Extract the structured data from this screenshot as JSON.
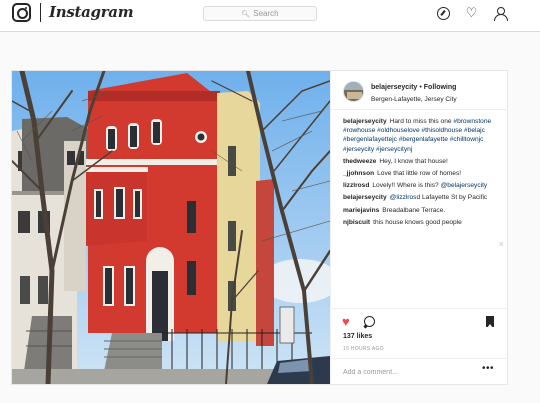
{
  "nav": {
    "wordmark": "Instagram",
    "search_placeholder": "Search",
    "icons": [
      "instagram-logo-icon",
      "compass-icon",
      "heart-icon",
      "profile-icon"
    ]
  },
  "post": {
    "author": "belajerseycity",
    "separator": "•",
    "follow_label": "Following",
    "location": "Bergen-Lafayette, Jersey City",
    "caption_text": "Hard to miss this one",
    "caption_tags": [
      "#brownstone",
      "#rowhouse",
      "#oldhouselove",
      "#thisoldhouse",
      "#belajc",
      "#bergenlafayettejc",
      "#bergenlafayette",
      "#chilltownjc",
      "#jerseycity",
      "#jerseycitynj"
    ],
    "comments": [
      {
        "user": "thedweeze",
        "text": "Hey, I know that house!"
      },
      {
        "user": "_jjohnson",
        "text": "Love that little row of homes!"
      },
      {
        "user": "lizzlrosd",
        "text": "Lovely!! Where is this?",
        "mention": "@belajerseycity"
      },
      {
        "user": "belajerseycity",
        "mention": "@lizzlrosd",
        "text": "Lafayette St by Pacific"
      },
      {
        "user": "mariejavins",
        "text": "Breadalbane Terrace."
      },
      {
        "user": "njbiscuit",
        "text": "this house knows good people"
      }
    ],
    "likes_text": "137 likes",
    "time_ago": "15 HOURS AGO",
    "add_comment_placeholder": "Add a comment...",
    "more_label": "•••",
    "close_label": "×"
  },
  "colors": {
    "link": "#003569",
    "like": "#ed4956",
    "border": "#dbdbdb",
    "background": "#fafafa",
    "house_red": "#d23a30"
  }
}
